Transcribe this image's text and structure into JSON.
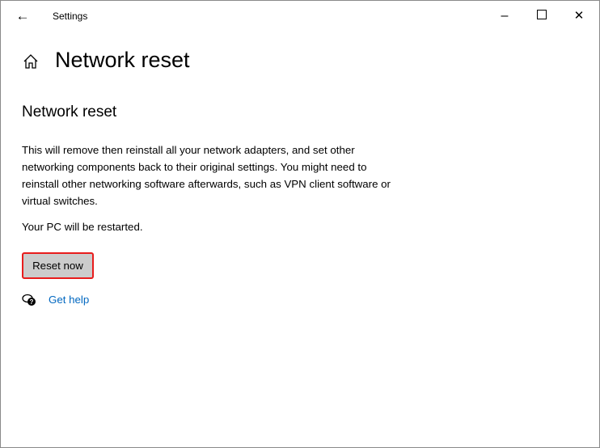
{
  "window": {
    "title": "Settings",
    "back_icon": "arrow-left-icon",
    "minimize_icon": "minimize-icon",
    "maximize_icon": "maximize-icon",
    "close_icon": "close-icon"
  },
  "header": {
    "title": "Network reset",
    "home_icon": "home-icon"
  },
  "section": {
    "title": "Network reset",
    "description": "This will remove then reinstall all your network adapters, and set other networking components back to their original settings. You might need to reinstall other networking software afterwards, such as VPN client software or virtual switches.",
    "restart_note": "Your PC will be restarted.",
    "reset_button": "Reset now",
    "help_link": "Get help"
  },
  "colors": {
    "highlight": "#e81c1c",
    "link": "#0067c0"
  }
}
